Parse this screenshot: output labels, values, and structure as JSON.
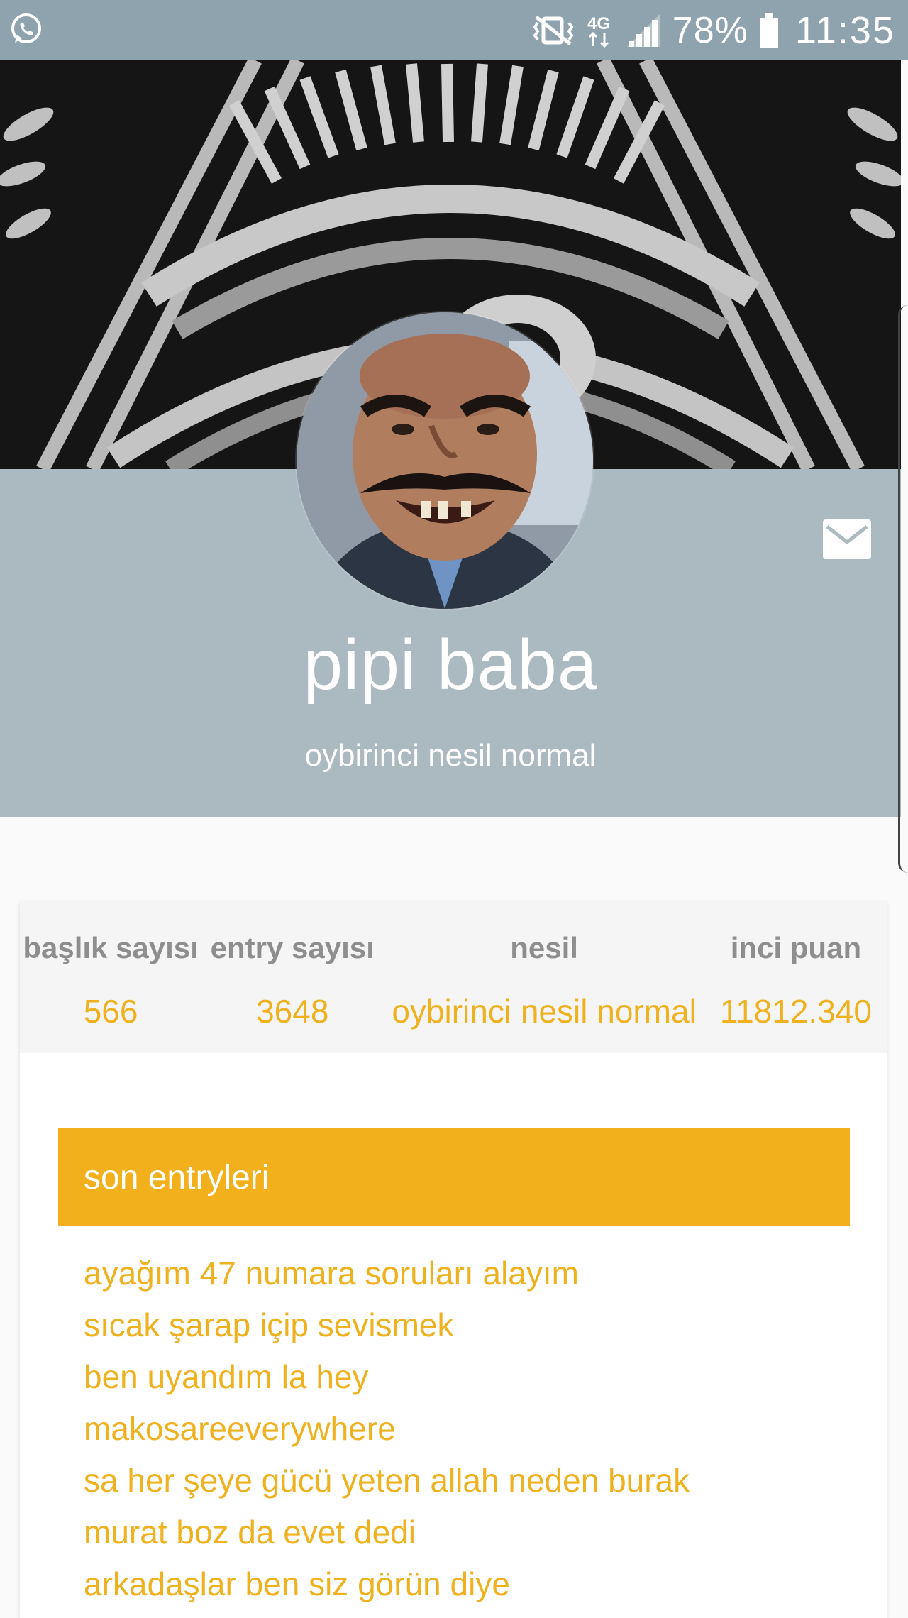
{
  "status_bar": {
    "battery_percent": "78%",
    "time": "11:35",
    "network": "4G",
    "icons": [
      "whatsapp-icon",
      "vibrate-mute-icon",
      "network-4g-icon",
      "signal-icon",
      "battery-icon"
    ]
  },
  "profile": {
    "username": "pipi baba",
    "generation_title": "oybirinci nesil normal",
    "message_icon": "envelope-icon"
  },
  "stats": [
    {
      "label": "başlık sayısı",
      "value": "566"
    },
    {
      "label": "entry sayısı",
      "value": "3648"
    },
    {
      "label": "nesil",
      "value": "oybirinci nesil normal"
    },
    {
      "label": "inci puan",
      "value": "11812.340"
    }
  ],
  "recent_entries": {
    "title": "son entryleri",
    "items": [
      "ayağım 47 numara soruları alayım",
      "sıcak şarap içip sevismek",
      "ben uyandım la hey",
      "makosareeverywhere",
      "sa her şeye gücü yeten allah neden burak",
      "murat boz da evet dedi",
      "arkadaşlar ben siz görün diye"
    ]
  },
  "colors": {
    "status_bar": "#8ea3ad",
    "header_bg": "#abb9c0",
    "accent": "#f2b11c",
    "stat_label": "#8e8e8e"
  }
}
